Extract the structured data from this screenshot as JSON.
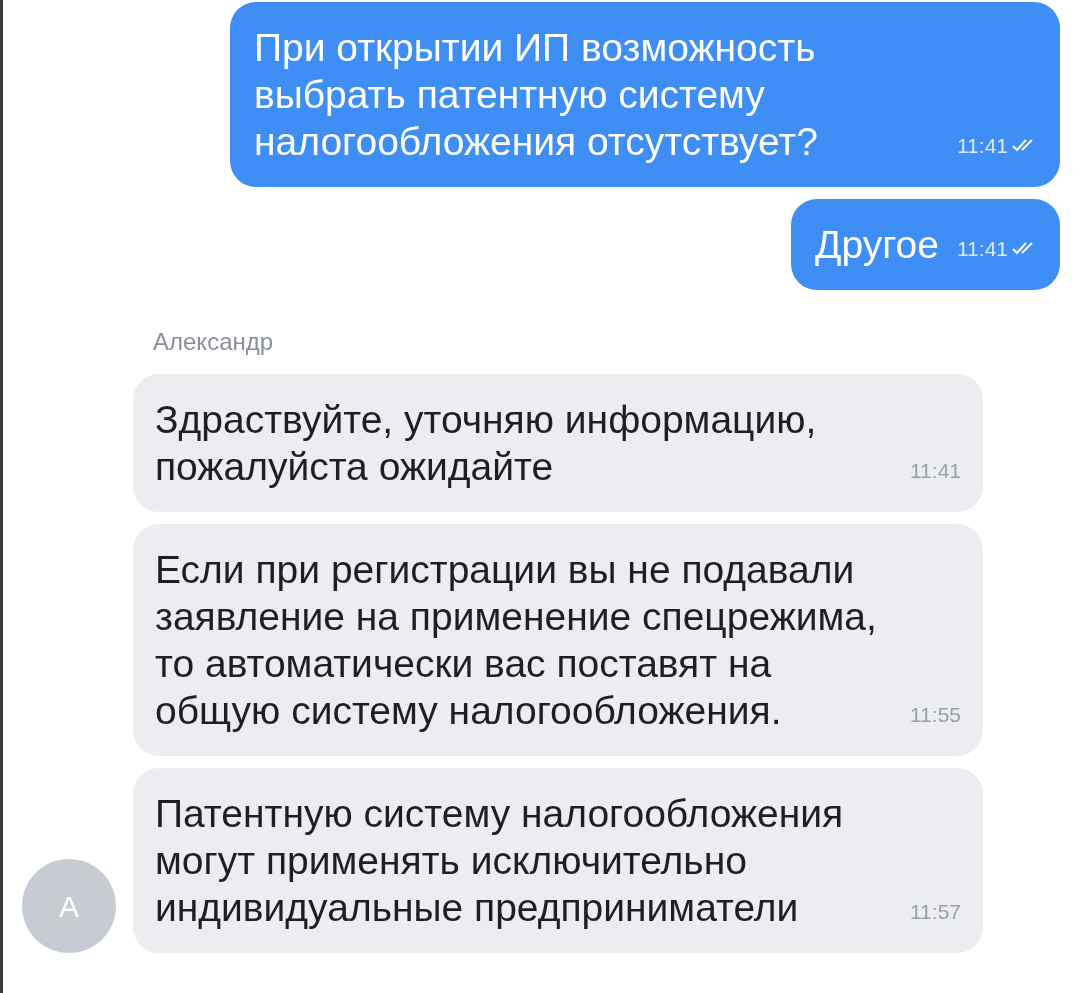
{
  "messages": [
    {
      "kind": "outgoing",
      "text": "При открытии ИП возможность выбрать патентную систему налогообложения отсутствует?",
      "time": "11:41",
      "read": true
    },
    {
      "kind": "outgoing",
      "text": "Другое",
      "time": "11:41",
      "read": true
    },
    {
      "kind": "sender",
      "text": "Александр"
    },
    {
      "kind": "incoming",
      "text": "Здраствуйте, уточняю информацию, пожалуйста ожидайте",
      "time": "11:41",
      "avatar": false
    },
    {
      "kind": "incoming",
      "text": "Если при регистрации вы не подавали заявление на применение спецрежима, то автоматически вас поставят на общую систему налогообложения.",
      "time": "11:55",
      "avatar": false
    },
    {
      "kind": "incoming",
      "text": "Патентную систему налогообложения могут применять исключительно индивидуальные предприниматели",
      "time": "11:57",
      "avatar": true,
      "avatar_letter": "А"
    }
  ]
}
